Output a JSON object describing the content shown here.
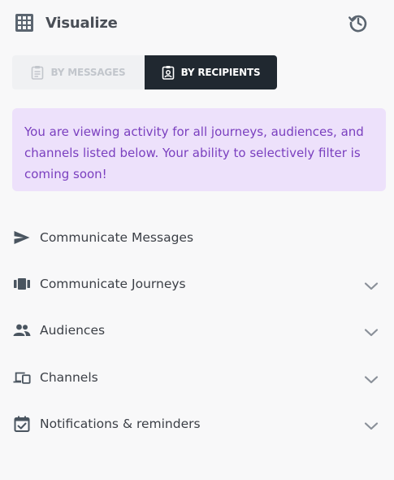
{
  "header": {
    "title": "Visualize",
    "logo_icon": "grid-table-icon",
    "history_icon": "history-icon"
  },
  "view_toggle": {
    "options": [
      {
        "label": "BY MESSAGES",
        "icon": "clipboard-icon",
        "selected": false
      },
      {
        "label": "BY RECIPIENTS",
        "icon": "contact-badge-icon",
        "selected": true
      }
    ]
  },
  "notice": {
    "text": "You are viewing activity for all journeys, audiences, and channels listed below. Your ability to selectively filter is coming soon!"
  },
  "menu": {
    "items": [
      {
        "label": "Communicate Messages",
        "icon": "send-icon",
        "expandable": false
      },
      {
        "label": "Communicate Journeys",
        "icon": "carousel-icon",
        "expandable": true
      },
      {
        "label": "Audiences",
        "icon": "people-icon",
        "expandable": true
      },
      {
        "label": "Channels",
        "icon": "devices-icon",
        "expandable": true
      },
      {
        "label": "Notifications & reminders",
        "icon": "calendar-check-icon",
        "expandable": true
      }
    ]
  },
  "colors": {
    "background": "#f8f8f9",
    "toggle_active_bg": "#202830",
    "toggle_inactive_bg": "#f0f1f3",
    "toggle_inactive_text": "#c2c6cc",
    "notice_bg": "#ede1fb",
    "notice_text": "#7a3fbf",
    "icon": "#4a5560",
    "chevron": "#8a9099"
  }
}
